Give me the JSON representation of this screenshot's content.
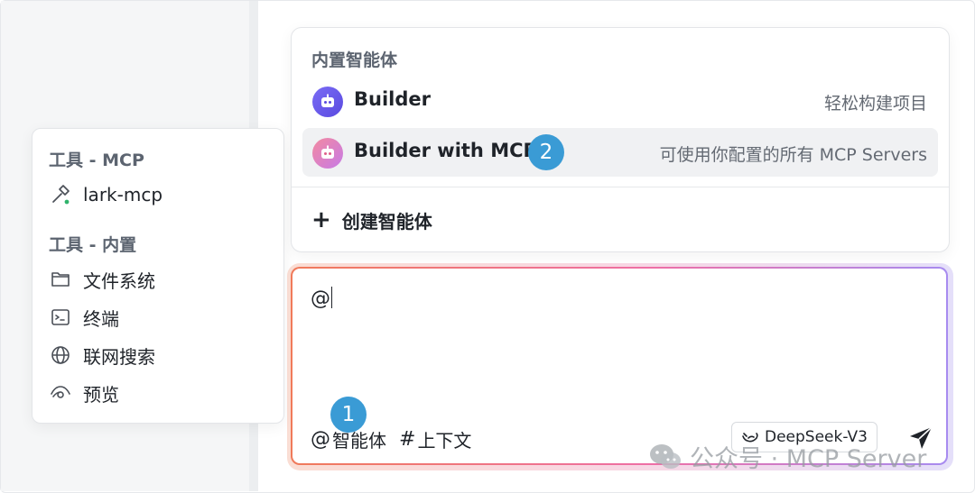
{
  "tools": {
    "mcp_header": "工具 - MCP",
    "mcp_items": [
      {
        "label": "lark-mcp",
        "icon": "hammer-icon"
      }
    ],
    "builtin_header": "工具 - 内置",
    "builtin_items": [
      {
        "label": "文件系统",
        "icon": "folder-icon"
      },
      {
        "label": "终端",
        "icon": "terminal-icon"
      },
      {
        "label": "联网搜索",
        "icon": "globe-icon"
      },
      {
        "label": "预览",
        "icon": "eye-icon"
      }
    ]
  },
  "agents": {
    "section_title": "内置智能体",
    "items": [
      {
        "name": "Builder",
        "description": "轻松构建项目",
        "icon": "robot-icon",
        "color": "#6b5cf0"
      },
      {
        "name": "Builder with MCP",
        "description": "可使用你配置的所有 MCP Servers",
        "icon": "robot-icon",
        "color": "#f06a86"
      }
    ],
    "create_label": "创建智能体"
  },
  "badges": {
    "one": "1",
    "two": "2",
    "color": "#3a9bd5"
  },
  "composer": {
    "text": "@",
    "agent_button": "智能体",
    "context_button": "上下文",
    "model": "DeepSeek-V3",
    "border_colors": [
      "#f07a5a",
      "#ee6fa6",
      "#a78bf0"
    ]
  },
  "watermark": "公众号 · MCP Server"
}
